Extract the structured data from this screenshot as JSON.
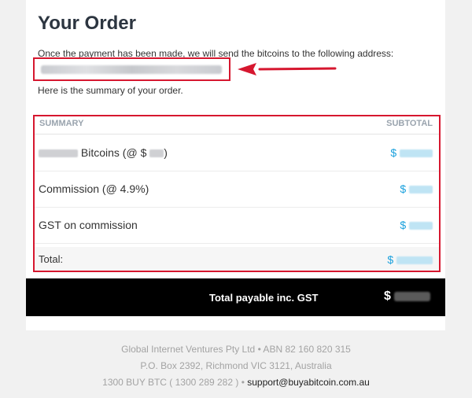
{
  "order": {
    "title": "Your Order",
    "intro": "Once the payment has been made, we will send the bitcoins to the following address:",
    "summary_note": "Here is the summary of your order."
  },
  "summary": {
    "col_left": "SUMMARY",
    "col_right": "SUBTOTAL",
    "rows": [
      {
        "label_prefix": "",
        "label": "Bitcoins (@ $",
        "label_suffix": ")",
        "value_prefix": "$"
      },
      {
        "label": "Commission (@ 4.9%)",
        "value_prefix": "$"
      },
      {
        "label": "GST on commission",
        "value_prefix": "$"
      }
    ],
    "total_label": "Total:",
    "total_value_prefix": "$"
  },
  "payable": {
    "label": "Total payable inc. GST",
    "currency": "$"
  },
  "footer": {
    "line1": "Global Internet Ventures Pty Ltd • ABN 82 160 820 315",
    "line2": "P.O. Box 2392, Richmond VIC 3121, Australia",
    "line3": "1300 BUY BTC ( 1300 289 282 ) • ",
    "email": "support@buyabitcoin.com.au"
  },
  "colors": {
    "highlight": "#d6172f",
    "link_blue": "#1ba1dd",
    "title": "#2c3540"
  }
}
